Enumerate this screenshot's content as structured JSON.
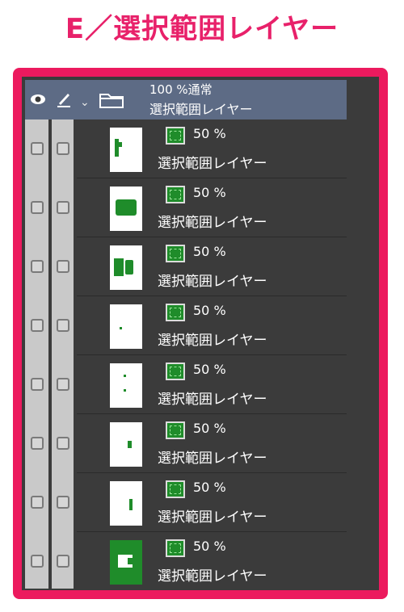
{
  "heading": "E／選択範囲レイヤー",
  "folder": {
    "opacity_mode": "100 %通常",
    "name": "選択範囲レイヤー"
  },
  "layers": [
    {
      "opacity": "50 %",
      "name": "選択範囲レイヤー"
    },
    {
      "opacity": "50 %",
      "name": "選択範囲レイヤー"
    },
    {
      "opacity": "50 %",
      "name": "選択範囲レイヤー"
    },
    {
      "opacity": "50 %",
      "name": "選択範囲レイヤー"
    },
    {
      "opacity": "50 %",
      "name": "選択範囲レイヤー"
    },
    {
      "opacity": "50 %",
      "name": "選択範囲レイヤー"
    },
    {
      "opacity": "50 %",
      "name": "選択範囲レイヤー"
    },
    {
      "opacity": "50 %",
      "name": "選択範囲レイヤー"
    }
  ],
  "icons": {
    "eye": "eye-icon",
    "pen": "pen-icon",
    "folder": "folder-icon",
    "chevron": "chevron-down-icon",
    "selection": "selection-layer-icon"
  },
  "colors": {
    "accent": "#ec1a5e",
    "folder_row": "#5d6b85",
    "panel": "#3b3b3b",
    "selection_green": "#1f8c2a"
  }
}
